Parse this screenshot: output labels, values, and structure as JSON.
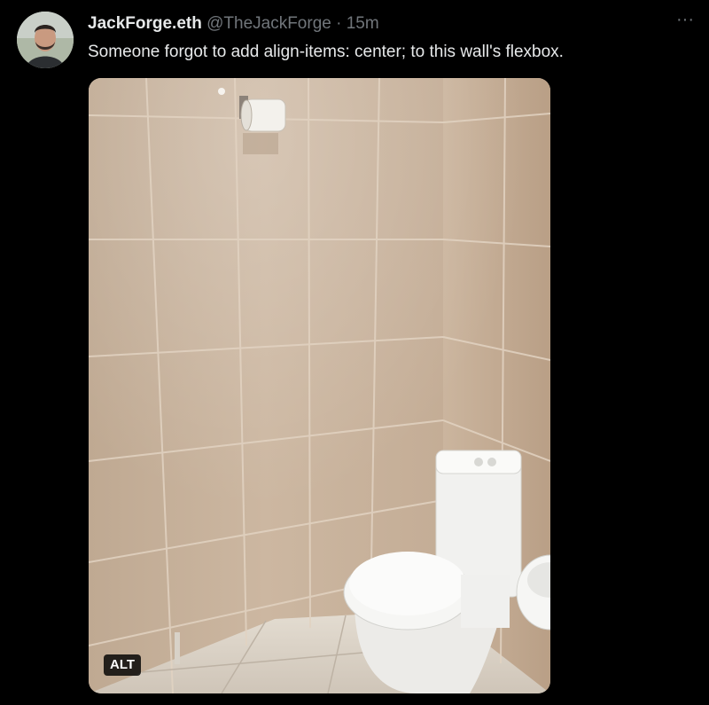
{
  "tweet": {
    "display_name": "JackForge.eth",
    "handle": "@TheJackForge",
    "separator": "·",
    "time": "15m",
    "more_label": "···",
    "text": "Someone forgot to add align-items: center; to this wall's flexbox."
  },
  "media": {
    "alt_label": "ALT"
  },
  "colors": {
    "background": "#000000",
    "primary_text": "#e7e9ea",
    "secondary_text": "#71767b",
    "tile": "#c6b19b",
    "grout": "#e6d8c8",
    "porcelain": "#f2f2f0"
  }
}
